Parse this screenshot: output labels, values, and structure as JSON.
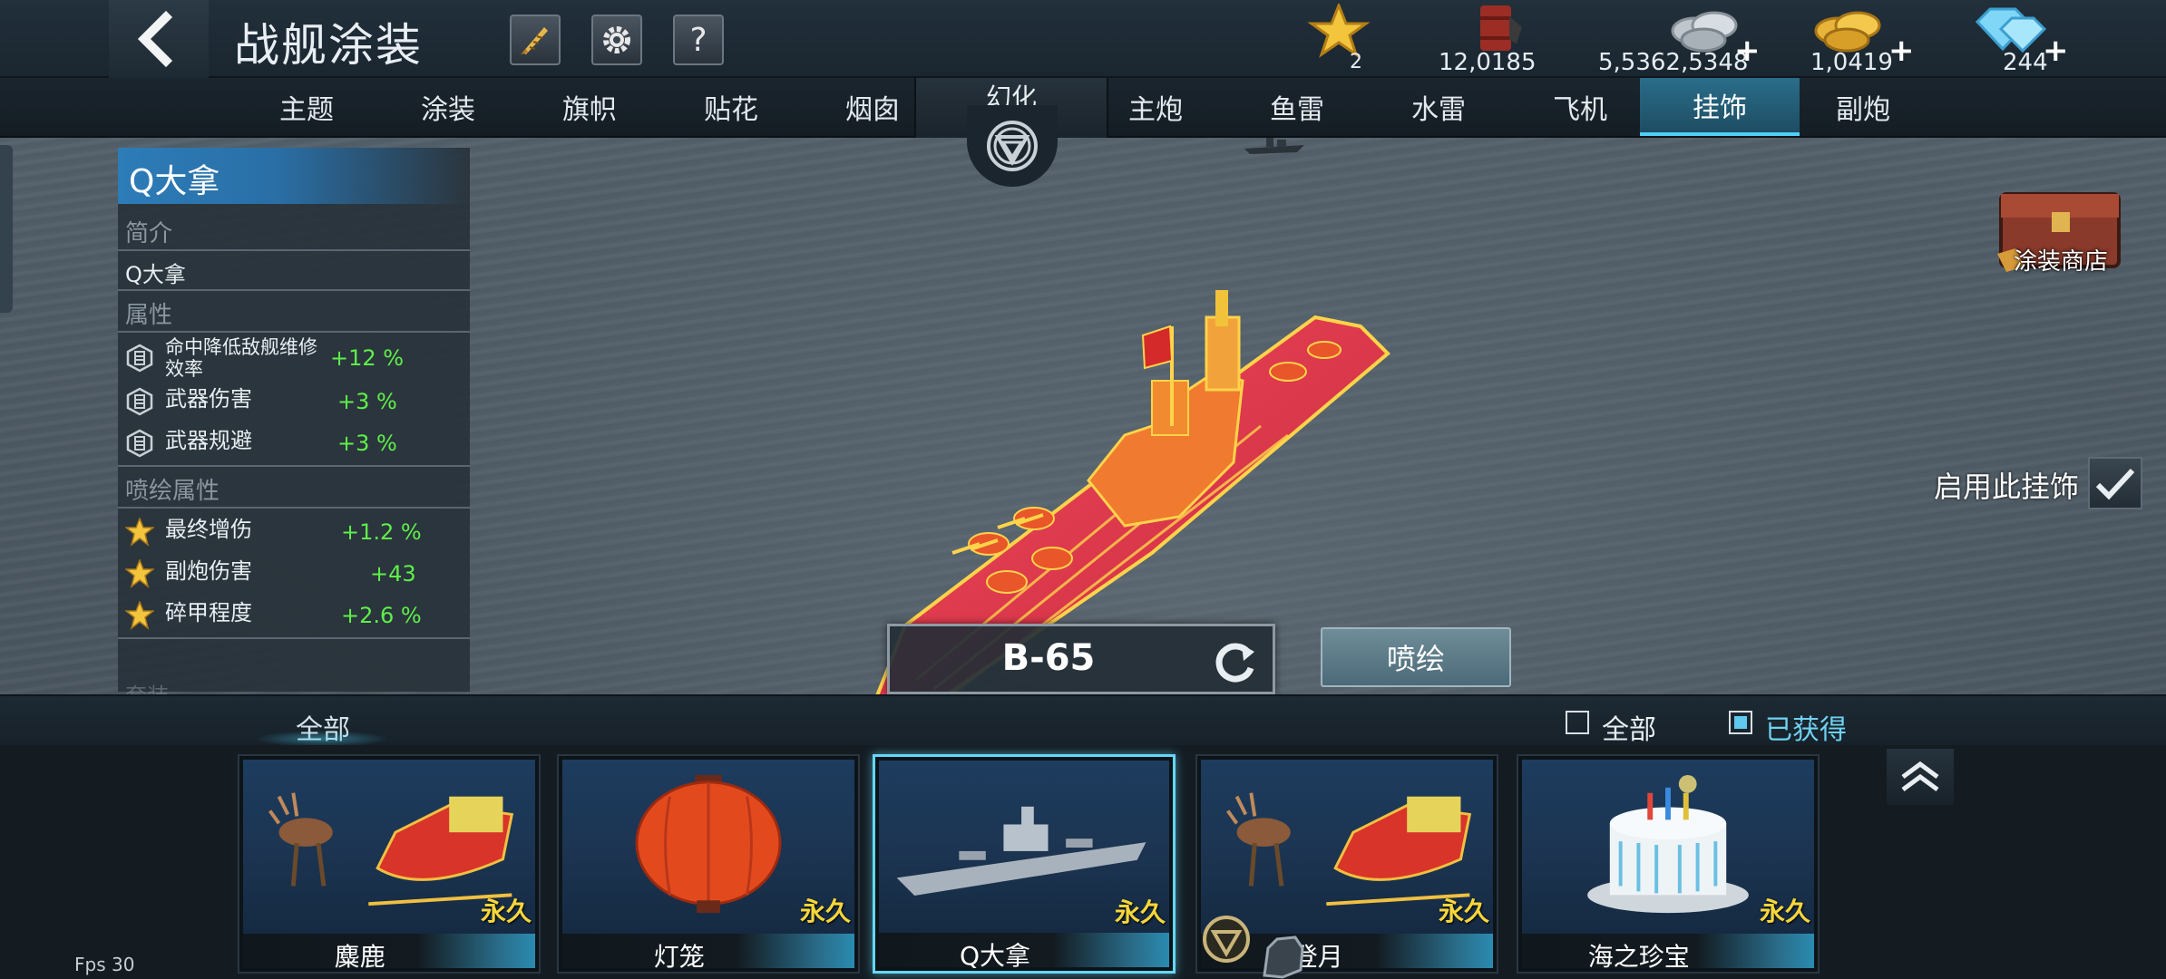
{
  "header": {
    "title": "战舰涂装",
    "help_label": "?"
  },
  "resources": {
    "star": "2",
    "fuel": "12,0185",
    "silver": "5,5362,5348",
    "gold": "1,0419",
    "diamond": "244",
    "plus": "+"
  },
  "tabs_left": [
    "主题",
    "涂装",
    "旗帜",
    "贴花",
    "烟囱"
  ],
  "center_tab": "幻化",
  "tabs_right": [
    "主炮",
    "鱼雷",
    "水雷",
    "飞机",
    "挂饰",
    "副炮"
  ],
  "active_tab": "挂饰",
  "info": {
    "name": "Q大拿",
    "intro_title": "简介",
    "intro_text": "Q大拿",
    "attr_title": "属性",
    "attrs": [
      {
        "label": "命中降低敌舰维修效率",
        "value": "+12 %"
      },
      {
        "label": "武器伤害",
        "value": "+3 %"
      },
      {
        "label": "武器规避",
        "value": "+3 %"
      }
    ],
    "spray_title": "喷绘属性",
    "spray_attrs": [
      {
        "label": "最终增伤",
        "value": "+1.2 %"
      },
      {
        "label": "副炮伤害",
        "value": "+43"
      },
      {
        "label": "碎甲程度",
        "value": "+2.6 %"
      }
    ],
    "more_title": "套装"
  },
  "shop_label": "涂装商店",
  "enable_label": "启用此挂饰",
  "code": "B-65",
  "spray_button": "喷绘",
  "filter": {
    "tab_all": "全部",
    "check_all": "全部",
    "check_owned": "已获得"
  },
  "cards": [
    {
      "name": "麋鹿",
      "tag": "永久"
    },
    {
      "name": "灯笼",
      "tag": "永久"
    },
    {
      "name": "Q大拿",
      "tag": "永久"
    },
    {
      "name": "登月",
      "tag": "永久"
    },
    {
      "name": "海之珍宝",
      "tag": "永久"
    }
  ],
  "fps": "Fps 30",
  "colors": {
    "active_tab": "#2a6d89",
    "selected_card_border": "#64d7f7",
    "positive_value": "#5ef04a",
    "permanent_tag": "#f7d63a",
    "ship_hull": "#e8405a"
  }
}
